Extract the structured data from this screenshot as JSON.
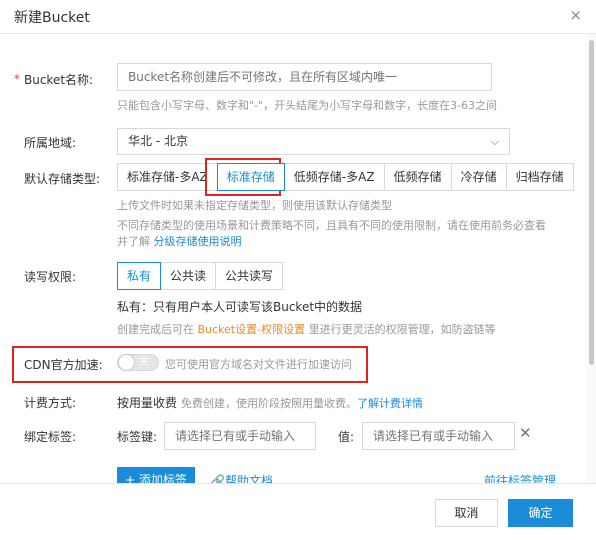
{
  "dialog": {
    "title": "新建Bucket",
    "close_glyph": "×"
  },
  "bucket_name": {
    "label": "Bucket名称:",
    "required_mark": "*",
    "placeholder": "Bucket名称创建后不可修改，且在所有区域内唯一",
    "help": "只能包含小写字母、数字和\"-\"，开头结尾为小写字母和数字，长度在3-63之间"
  },
  "region": {
    "label": "所属地域:",
    "value": "华北 - 北京",
    "chevron": "⌵"
  },
  "storage_class": {
    "label": "默认存储类型:",
    "options": [
      "标准存储-多AZ",
      "标准存储",
      "低频存储-多AZ",
      "低频存储",
      "冷存储",
      "归档存储"
    ],
    "selected": "标准存储",
    "help1": "上传文件时如果未指定存储类型，则使用该默认存储类型",
    "help2_line1": "不同存储类型的使用场景和计费策略不同，且具有不同的使用限制，请在使用前务必查看",
    "help2_line2_prefix": "并了解 ",
    "help2_link": "分级存储使用说明"
  },
  "acl": {
    "label": "读写权限:",
    "options": [
      "私有",
      "公共读",
      "公共读写"
    ],
    "selected": "私有",
    "desc": "私有：只有用户本人可读写该Bucket中的数据",
    "help_prefix": "创建完成后可在 ",
    "help_link": "Bucket设置-权限设置",
    "help_suffix": " 里进行更灵活的权限管理，如防盗链等"
  },
  "cdn": {
    "label": "CDN官方加速:",
    "toggle_text": "关",
    "toggle_on": false,
    "desc": "您可使用官方域名对文件进行加速访问"
  },
  "billing": {
    "label": "计费方式:",
    "value": "按用量收费",
    "desc": "免费创建，使用阶段按照用量收费。",
    "link": "了解计费详情"
  },
  "tags": {
    "label": "绑定标签:",
    "key_label": "标签键:",
    "key_placeholder": "请选择已有或手动输入",
    "value_label": "值:",
    "value_placeholder": "请选择已有或手动输入",
    "remove_glyph": "✕",
    "add_button": "+ 添加标签",
    "help_doc": "帮助文档",
    "manage": "前往标签管理"
  },
  "footer": {
    "cancel": "取消",
    "confirm": "确定"
  },
  "colors": {
    "primary": "#1a8cd8",
    "highlight": "#e02222",
    "required": "#e8422f",
    "link_orange": "#f08a24"
  }
}
